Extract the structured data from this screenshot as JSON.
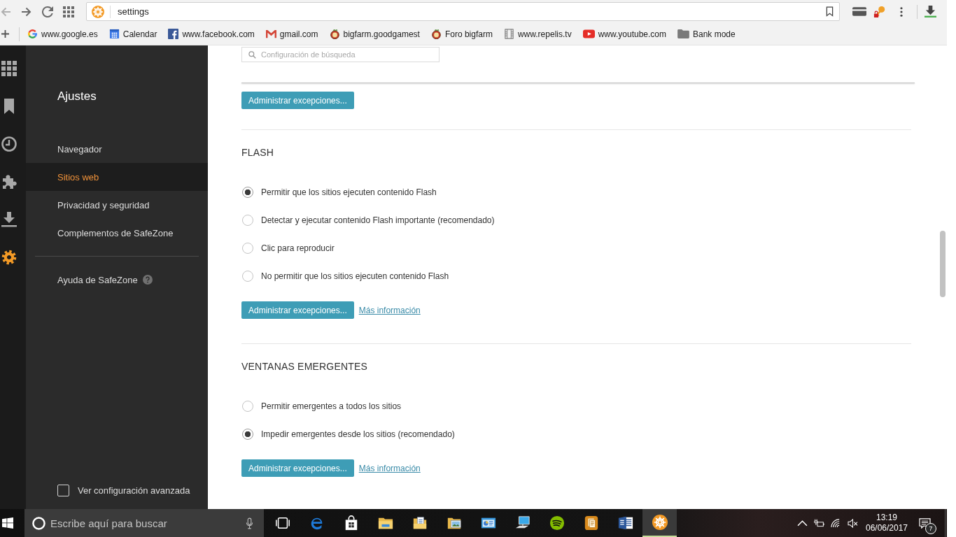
{
  "browser": {
    "address": "settings",
    "bookmarks": [
      {
        "kind": "g-logo",
        "label": "www.google.es"
      },
      {
        "kind": "calendar",
        "label": "Calendar"
      },
      {
        "kind": "f-logo",
        "label": "www.facebook.com"
      },
      {
        "kind": "m-logo",
        "label": "gmail.com"
      },
      {
        "kind": "fruit",
        "label": "bigfarm.goodgamest"
      },
      {
        "kind": "fruit",
        "label": "Foro bigfarm"
      },
      {
        "kind": "film",
        "label": "www.repelis.tv"
      },
      {
        "kind": "play",
        "label": "www.youtube.com"
      },
      {
        "kind": "folder",
        "label": "Bank mode"
      }
    ]
  },
  "rail": [
    {
      "kind": "grid",
      "selected": false
    },
    {
      "kind": "bookmark",
      "selected": false
    },
    {
      "kind": "clock",
      "selected": false
    },
    {
      "kind": "puzzle",
      "selected": false
    },
    {
      "kind": "download",
      "selected": false
    },
    {
      "kind": "gear",
      "selected": true
    }
  ],
  "sidebar": {
    "title": "Ajustes",
    "items": [
      {
        "label": "Navegador",
        "selected": false
      },
      {
        "label": "Sitios web",
        "selected": true
      },
      {
        "label": "Privacidad y seguridad",
        "selected": false
      },
      {
        "label": "Complementos de SafeZone",
        "selected": false
      }
    ],
    "help": "Ayuda de SafeZone",
    "advanced": {
      "label": "Ver configuración avanzada",
      "checked": false
    }
  },
  "content": {
    "search_field": {
      "placeholder": "Configuración de búsqueda"
    },
    "sections": [
      {
        "button": "Administrar excepciones..."
      },
      {
        "title": "FLASH",
        "options": [
          {
            "label": "Permitir que los sitios ejecuten contenido Flash",
            "selected": true
          },
          {
            "label": "Detectar y ejecutar contenido Flash importante (recomendado)",
            "selected": false
          },
          {
            "label": "Clic para reproducir",
            "selected": false
          },
          {
            "label": "No permitir que los sitios ejecuten contenido Flash",
            "selected": false
          }
        ],
        "button": "Administrar excepciones...",
        "link": "Más información"
      },
      {
        "title": "VENTANAS EMERGENTES",
        "options": [
          {
            "label": "Permitir emergentes a todos los sitios",
            "selected": false
          },
          {
            "label": "Impedir emergentes desde los sitios (recomendado)",
            "selected": true
          }
        ],
        "button": "Administrar excepciones...",
        "link": "Más información"
      }
    ]
  },
  "taskbar": {
    "search_placeholder": "Escribe aquí para buscar",
    "apps": [
      {
        "kind": "task-view",
        "selected": false
      },
      {
        "kind": "e-logo",
        "selected": false
      },
      {
        "kind": "bag",
        "selected": false
      },
      {
        "kind": "folder",
        "selected": false
      },
      {
        "kind": "document-folder",
        "selected": false
      },
      {
        "kind": "picture-folder",
        "selected": false
      },
      {
        "kind": "window-chart",
        "selected": false
      },
      {
        "kind": "computer",
        "selected": false
      },
      {
        "kind": "waves",
        "selected": false
      },
      {
        "kind": "document-stack",
        "selected": false
      },
      {
        "kind": "lined-document",
        "selected": false
      },
      {
        "kind": "ship-wheel",
        "selected": true
      }
    ],
    "time": "13:19",
    "date": "06/06/2017",
    "notifications": "7"
  }
}
